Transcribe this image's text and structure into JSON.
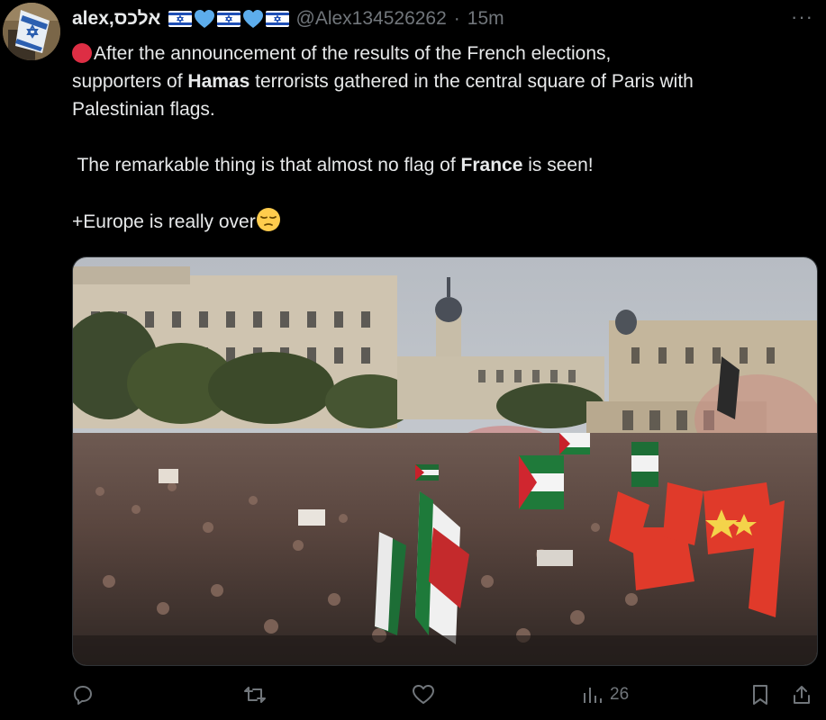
{
  "tweet": {
    "display_name": "alex,אלכס",
    "handle": "@Alex134526262",
    "separator": "·",
    "time": "15m",
    "more_label": "···",
    "line1_text": "After the announcement of the results of the French elections,",
    "line2_pre": "supporters of ",
    "line2_bold": "Hamas",
    "line2_post": " terrorists gathered in the central square of Paris with",
    "line3_text": "Palestinian flags.",
    "line4_pre": " The remarkable thing is that almost no flag of ",
    "line4_bold": "France",
    "line4_post": " is seen!",
    "line5_text": "+Europe is really over"
  },
  "emojis": {
    "name_suffix": [
      "israel-flag",
      "blue-heart",
      "israel-flag",
      "blue-heart",
      "israel-flag"
    ],
    "lead": "red-circle",
    "trail": "pensive-face"
  },
  "actions": {
    "views_count": "26"
  },
  "colors": {
    "background": "#000000",
    "text": "#e7e9ea",
    "muted": "#71767b",
    "blue_heart": "#5dadec",
    "red_circle": "#dd2e44"
  }
}
